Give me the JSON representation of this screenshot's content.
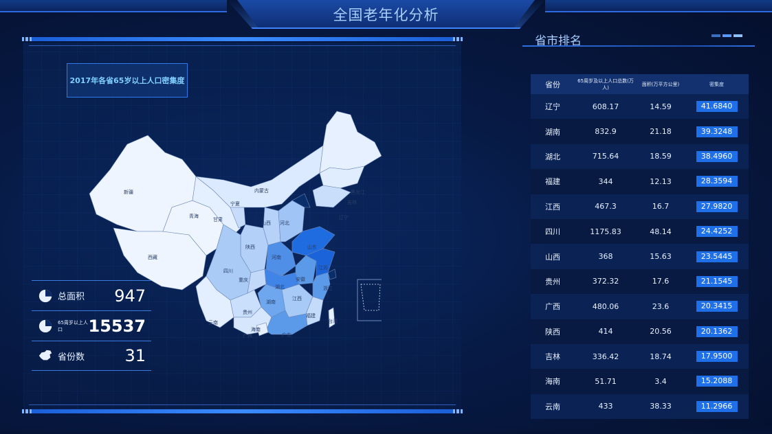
{
  "header": {
    "title": "全国老年化分析"
  },
  "map_panel": {
    "map_title": "2017年各省65岁以上人口密集度",
    "stats": [
      {
        "icon": "pie-chart-icon",
        "label": "总面积",
        "value": "947"
      },
      {
        "icon": "pie-chart-icon",
        "label": "65周岁以上人口",
        "value": "15537"
      },
      {
        "icon": "china-map-icon",
        "label": "省份数",
        "value": "31"
      }
    ],
    "map_labels": [
      "新疆",
      "西藏",
      "青海",
      "甘肃",
      "内蒙古",
      "宁夏",
      "陕西",
      "山西",
      "河北",
      "山东",
      "河南",
      "四川",
      "重庆",
      "湖北",
      "安徽",
      "江苏",
      "浙江",
      "湖南",
      "江西",
      "贵州",
      "云南",
      "广西",
      "广东",
      "福建",
      "海南",
      "黑龙江",
      "吉林",
      "辽宁",
      "台湾"
    ]
  },
  "ranking": {
    "title": "省市排名",
    "headers": [
      "省份",
      "65周岁及以上人口总数(万人)",
      "面积(万平方公里)",
      "密集度"
    ],
    "rows": [
      [
        "辽宁",
        "608.17",
        "14.59",
        "41.6840"
      ],
      [
        "湖南",
        "832.9",
        "21.18",
        "39.3248"
      ],
      [
        "湖北",
        "715.64",
        "18.59",
        "38.4960"
      ],
      [
        "福建",
        "344",
        "12.13",
        "28.3594"
      ],
      [
        "江西",
        "467.3",
        "16.7",
        "27.9820"
      ],
      [
        "四川",
        "1175.83",
        "48.14",
        "24.4252"
      ],
      [
        "山西",
        "368",
        "15.63",
        "23.5445"
      ],
      [
        "贵州",
        "372.32",
        "17.6",
        "21.1545"
      ],
      [
        "广西",
        "480.06",
        "23.6",
        "20.3415"
      ],
      [
        "陕西",
        "414",
        "20.56",
        "20.1362"
      ],
      [
        "吉林",
        "336.42",
        "18.74",
        "17.9500"
      ],
      [
        "海南",
        "51.71",
        "3.4",
        "15.2088"
      ],
      [
        "云南",
        "433",
        "38.33",
        "11.2966"
      ]
    ]
  },
  "colors": {
    "accent": "#1f6fe8",
    "background": "#071a45",
    "title": "#a9cfff"
  }
}
